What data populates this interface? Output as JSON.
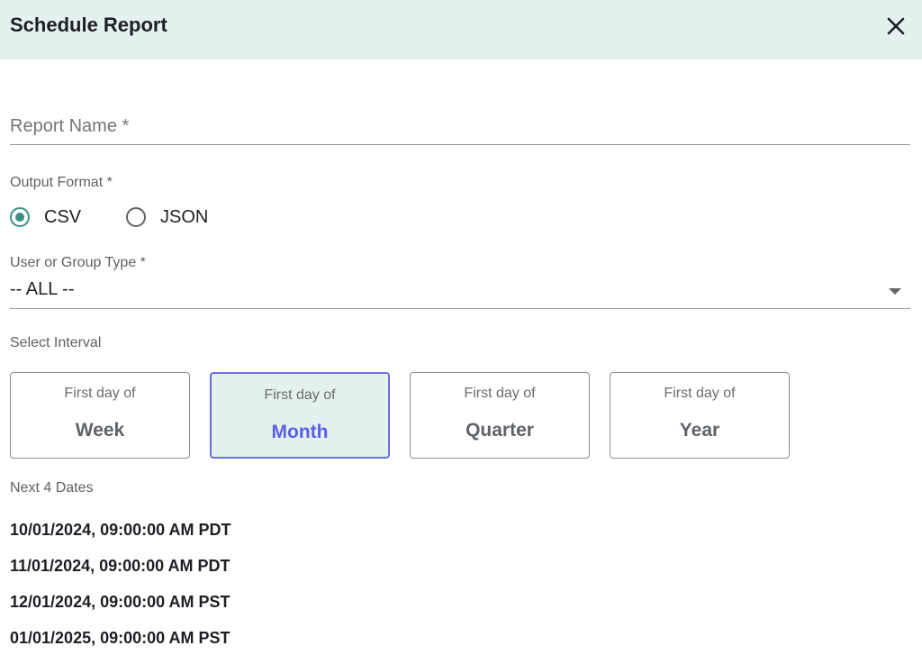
{
  "dialog": {
    "title": "Schedule Report",
    "close_icon": "close-icon"
  },
  "report_name": {
    "placeholder": "Report Name *",
    "value": ""
  },
  "output_format": {
    "label": "Output Format *",
    "options": [
      {
        "label": "CSV",
        "selected": true
      },
      {
        "label": "JSON",
        "selected": false
      }
    ]
  },
  "user_group": {
    "label": "User or Group Type *",
    "value": "-- ALL --",
    "caret_icon": "caret-down-icon"
  },
  "interval": {
    "label": "Select Interval",
    "options": [
      {
        "prefix": "First day of",
        "name": "Week",
        "selected": false
      },
      {
        "prefix": "First day of",
        "name": "Month",
        "selected": true
      },
      {
        "prefix": "First day of",
        "name": "Quarter",
        "selected": false
      },
      {
        "prefix": "First day of",
        "name": "Year",
        "selected": false
      }
    ]
  },
  "next_dates": {
    "label": "Next 4 Dates",
    "dates": [
      "10/01/2024, 09:00:00 AM PDT",
      "11/01/2024, 09:00:00 AM PDT",
      "12/01/2024, 09:00:00 AM PST",
      "01/01/2025, 09:00:00 AM PST"
    ]
  },
  "colors": {
    "header_bg": "#e4f1ef",
    "accent_teal": "#3a8f84",
    "selected_border": "#6a6fe0",
    "selected_text": "#5b5fe0"
  }
}
